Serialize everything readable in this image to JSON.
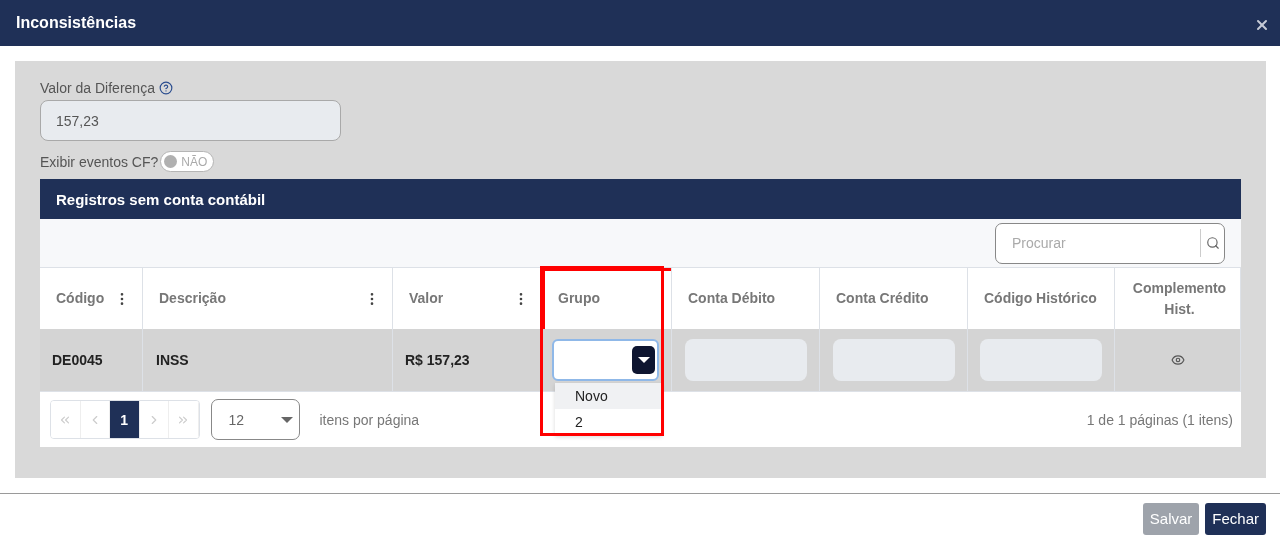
{
  "dialog": {
    "title": "Inconsistências"
  },
  "difference": {
    "label": "Valor da Diferença",
    "value": "157,23"
  },
  "cf_toggle": {
    "label": "Exibir eventos CF?",
    "on": false,
    "state_text": "NÃO"
  },
  "grid": {
    "title": "Registros sem conta contábil",
    "search": {
      "placeholder": "Procurar"
    },
    "columns": [
      {
        "label": "Código",
        "has_menu": true
      },
      {
        "label": "Descrição",
        "has_menu": true
      },
      {
        "label": "Valor",
        "has_menu": true
      },
      {
        "label": "Grupo",
        "has_menu": false,
        "highlighted": true
      },
      {
        "label": "Conta Débito",
        "has_menu": false
      },
      {
        "label": "Conta Crédito",
        "has_menu": false
      },
      {
        "label": "Código Histórico",
        "has_menu": false
      },
      {
        "label": "Complemento Hist.",
        "has_menu": false
      }
    ],
    "rows": [
      {
        "codigo": "DE0045",
        "descricao": "INSS",
        "valor": "R$ 157,23",
        "grupo": {
          "expanded": true,
          "options": [
            {
              "label": "Novo",
              "hovered": true
            },
            {
              "label": "2",
              "hovered": false
            }
          ]
        }
      }
    ],
    "pager": {
      "buttons": [
        {
          "kind": "first",
          "disabled": true,
          "selected": false
        },
        {
          "kind": "prev",
          "disabled": true,
          "selected": false
        },
        {
          "kind": "page",
          "label": "1",
          "disabled": false,
          "selected": true
        },
        {
          "kind": "next",
          "disabled": true,
          "selected": false
        },
        {
          "kind": "last",
          "disabled": true,
          "selected": false
        }
      ],
      "page_size": "12",
      "page_size_label": "itens por página",
      "summary": "1 de 1 páginas (1 itens)"
    }
  },
  "footer": {
    "buttons": [
      {
        "label": "Salvar",
        "disabled": true
      },
      {
        "label": "Fechar",
        "disabled": false
      }
    ]
  }
}
